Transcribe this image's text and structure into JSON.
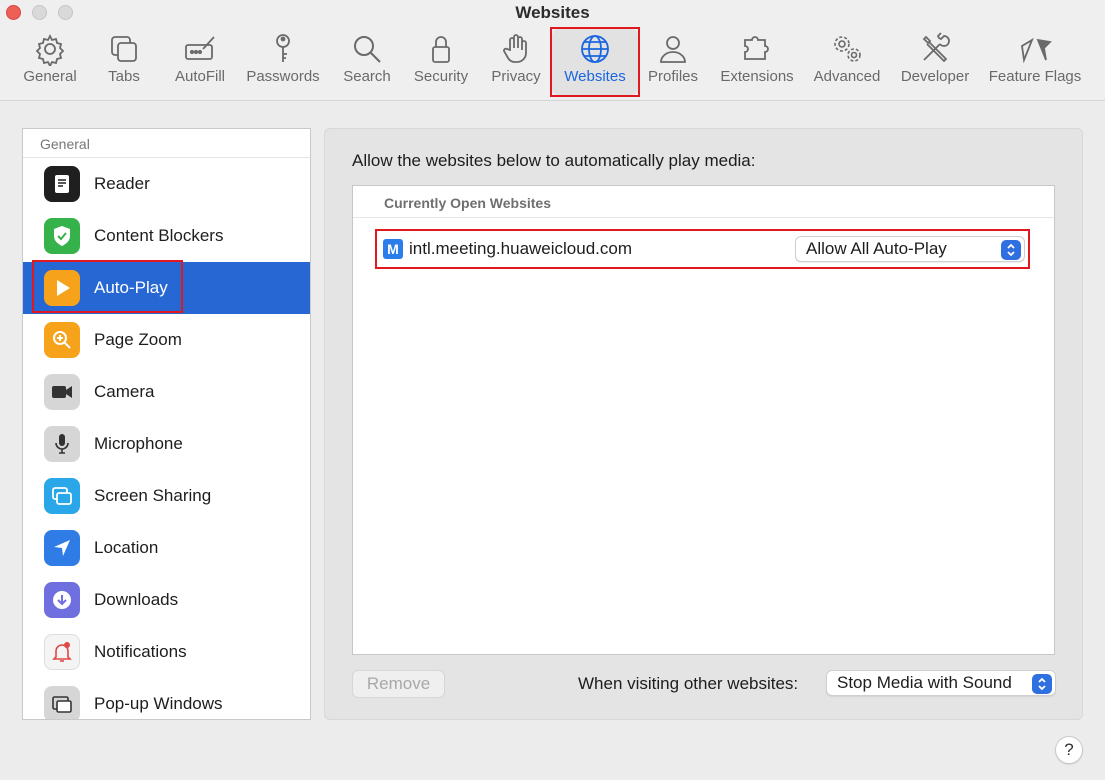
{
  "window": {
    "title": "Websites"
  },
  "toolbar": {
    "items": [
      {
        "label": "General",
        "icon": "gear-icon"
      },
      {
        "label": "Tabs",
        "icon": "tabs-icon"
      },
      {
        "label": "AutoFill",
        "icon": "autofill-icon"
      },
      {
        "label": "Passwords",
        "icon": "key-icon"
      },
      {
        "label": "Search",
        "icon": "search-icon"
      },
      {
        "label": "Security",
        "icon": "lock-icon"
      },
      {
        "label": "Privacy",
        "icon": "hand-icon"
      },
      {
        "label": "Websites",
        "icon": "globe-icon",
        "selected": true
      },
      {
        "label": "Profiles",
        "icon": "person-icon"
      },
      {
        "label": "Extensions",
        "icon": "puzzle-icon"
      },
      {
        "label": "Advanced",
        "icon": "gears-icon"
      },
      {
        "label": "Developer",
        "icon": "tools-icon"
      },
      {
        "label": "Feature Flags",
        "icon": "flags-icon"
      }
    ]
  },
  "sidebar": {
    "header": "General",
    "items": [
      {
        "label": "Reader",
        "icon": "reader-icon"
      },
      {
        "label": "Content Blockers",
        "icon": "shield-icon"
      },
      {
        "label": "Auto-Play",
        "icon": "play-icon",
        "selected": true
      },
      {
        "label": "Page Zoom",
        "icon": "zoom-icon"
      },
      {
        "label": "Camera",
        "icon": "camera-icon"
      },
      {
        "label": "Microphone",
        "icon": "microphone-icon"
      },
      {
        "label": "Screen Sharing",
        "icon": "screen-sharing-icon"
      },
      {
        "label": "Location",
        "icon": "location-icon"
      },
      {
        "label": "Downloads",
        "icon": "downloads-icon"
      },
      {
        "label": "Notifications",
        "icon": "bell-icon"
      },
      {
        "label": "Pop-up Windows",
        "icon": "popup-windows-icon"
      }
    ]
  },
  "main": {
    "description": "Allow the websites below to automatically play media:",
    "list_header": "Currently Open Websites",
    "sites": [
      {
        "favicon_letter": "M",
        "domain": "intl.meeting.huaweicloud.com",
        "setting": "Allow All Auto-Play"
      }
    ],
    "remove_label": "Remove",
    "other_label": "When visiting other websites:",
    "other_setting": "Stop Media with Sound",
    "help_label": "?"
  },
  "colors": {
    "accent": "#1b66e0",
    "selection": "#2767d4",
    "highlight_box": "#e0181f"
  }
}
